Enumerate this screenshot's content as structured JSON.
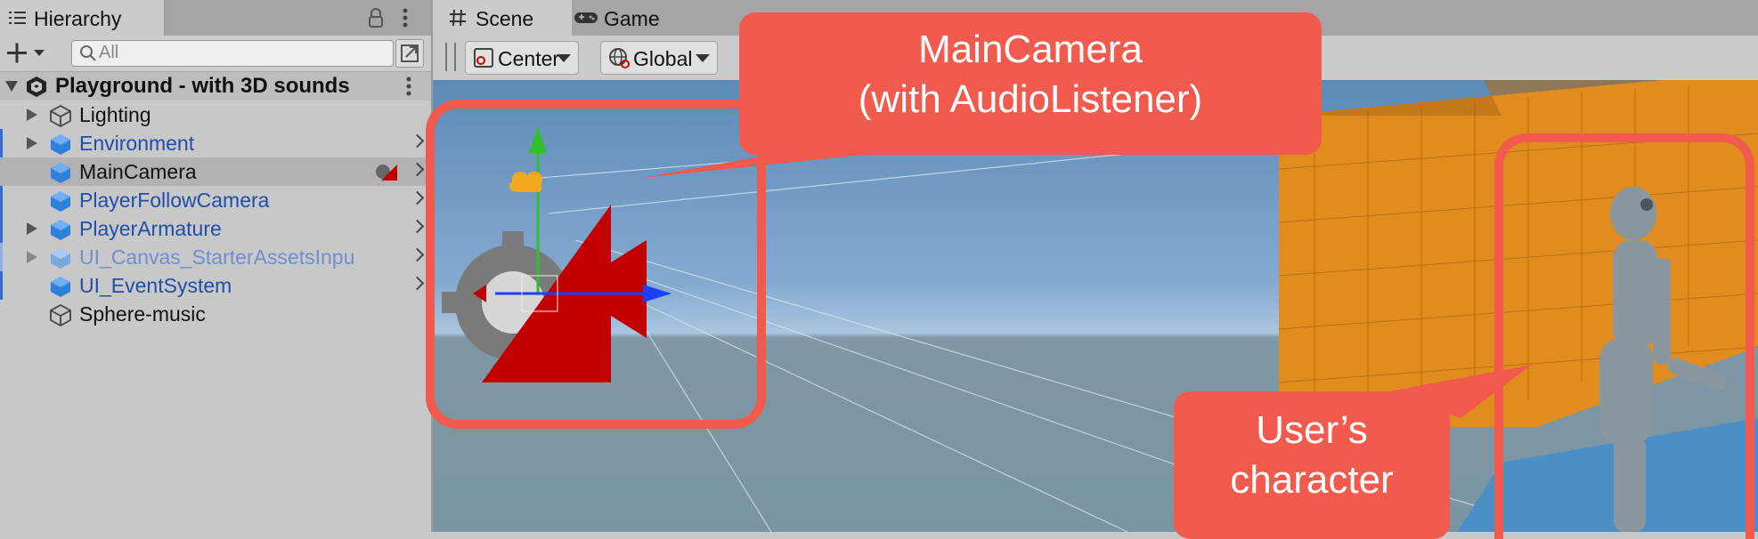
{
  "hierarchy": {
    "tab_title": "Hierarchy",
    "search_placeholder": "All",
    "scene_name": "Playground - with 3D sounds",
    "items": [
      {
        "label": "Lighting",
        "style": "normal"
      },
      {
        "label": "Environment",
        "style": "blue"
      },
      {
        "label": "MainCamera",
        "style": "selected"
      },
      {
        "label": "PlayerFollowCamera",
        "style": "blue"
      },
      {
        "label": "PlayerArmature",
        "style": "blue"
      },
      {
        "label": "UI_Canvas_StarterAssetsInpu",
        "style": "blue-light"
      },
      {
        "label": "UI_EventSystem",
        "style": "blue"
      },
      {
        "label": "Sphere-music",
        "style": "normal"
      }
    ]
  },
  "scene": {
    "tab_scene": "Scene",
    "tab_game": "Game",
    "pivot_mode": "Center",
    "pivot_rotation": "Global"
  },
  "callouts": {
    "camera_line1": "MainCamera",
    "camera_line2": "(with AudioListener)",
    "character_line1": "User’s",
    "character_line2": "character"
  },
  "colors": {
    "callout": "#f15a4c",
    "prefab_blue": "#1f4fa8",
    "panel_bg": "#c8c8c8"
  }
}
